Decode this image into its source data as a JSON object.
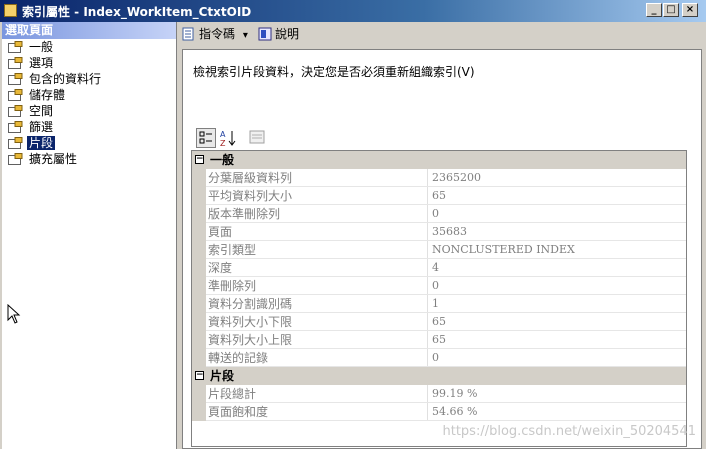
{
  "window": {
    "title": "索引屬性 - Index_WorkItem_CtxtOID",
    "controls": [
      "_",
      "□",
      "×"
    ]
  },
  "sidebar": {
    "header": "選取頁面",
    "items": [
      {
        "label": "一般",
        "selected": false
      },
      {
        "label": "選項",
        "selected": false
      },
      {
        "label": "包含的資料行",
        "selected": false
      },
      {
        "label": "儲存體",
        "selected": false
      },
      {
        "label": "空間",
        "selected": false
      },
      {
        "label": "篩選",
        "selected": false
      },
      {
        "label": "片段",
        "selected": true
      },
      {
        "label": "擴充屬性",
        "selected": false
      }
    ]
  },
  "toolbar": {
    "script_label": "指令碼",
    "script_arrow": "▾",
    "help_label": "說明"
  },
  "main": {
    "description": "檢視索引片段資料，決定您是否必須重新組織索引(V)",
    "categories": [
      {
        "name": "一般",
        "expander": "−",
        "properties": [
          {
            "name": "分葉層級資料列",
            "value": "2365200"
          },
          {
            "name": "平均資料列大小",
            "value": "65"
          },
          {
            "name": "版本準刪除列",
            "value": "0"
          },
          {
            "name": "頁面",
            "value": "35683"
          },
          {
            "name": "索引類型",
            "value": "NONCLUSTERED INDEX"
          },
          {
            "name": "深度",
            "value": "4"
          },
          {
            "name": "準刪除列",
            "value": "0"
          },
          {
            "name": "資料分割識別碼",
            "value": "1"
          },
          {
            "name": "資料列大小下限",
            "value": "65"
          },
          {
            "name": "資料列大小上限",
            "value": "65"
          },
          {
            "name": "轉送的記錄",
            "value": "0"
          }
        ]
      },
      {
        "name": "片段",
        "expander": "−",
        "properties": [
          {
            "name": "片段總計",
            "value": "99.19 %"
          },
          {
            "name": "頁面飽和度",
            "value": "54.66 %"
          }
        ]
      }
    ]
  },
  "watermark": "https://blog.csdn.net/weixin_50204541",
  "colors": {
    "title_bar": "#0a246a",
    "selection": "#0a246a",
    "panel": "#d4d0c8",
    "sidebar_header": "#7a96df"
  }
}
